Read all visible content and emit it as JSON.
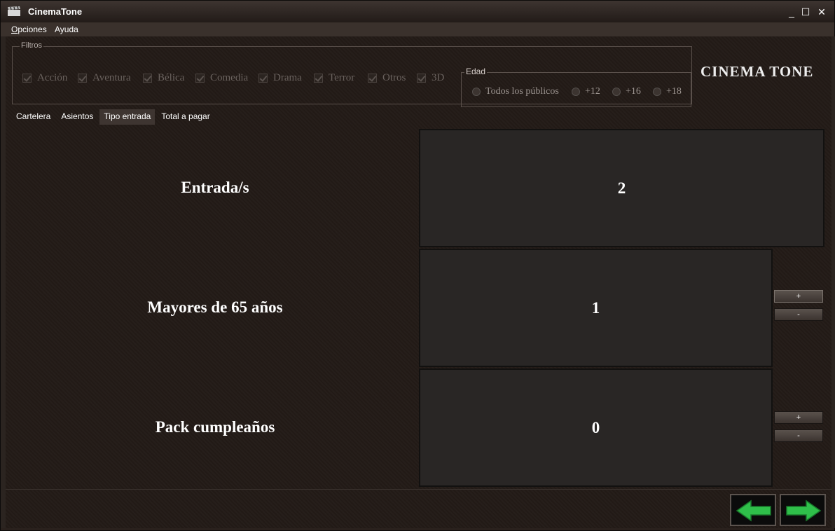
{
  "window": {
    "title": "CinemaTone",
    "minimize": "_",
    "maximize": "☐",
    "close": "✕"
  },
  "menu": {
    "opciones": {
      "accel": "O",
      "rest": "pciones"
    },
    "ayuda": "Ayuda"
  },
  "filtros": {
    "title": "Filtros",
    "genres": [
      "Acción",
      "Aventura",
      "Bélica",
      "Comedia",
      "Drama",
      "Terror",
      "Otros",
      "3D"
    ]
  },
  "edad": {
    "title": "Edad",
    "options": [
      "Todos los públicos",
      "+12",
      "+16",
      "+18"
    ]
  },
  "brand": "CINEMA TONE",
  "tabs": [
    "Cartelera",
    "Asientos",
    "Tipo entrada",
    "Total a pagar"
  ],
  "active_tab": "Tipo entrada",
  "rows": [
    {
      "label": "Entrada/s",
      "value": "2"
    },
    {
      "label": "Mayores de 65 años",
      "value": "1"
    },
    {
      "label": "Pack cumpleaños",
      "value": "0"
    }
  ],
  "stepper": {
    "plus": "+",
    "minus": "-"
  },
  "colors": {
    "accent_arrow": "#2fbf4a",
    "background": "#231b17"
  },
  "icons": {
    "back": "left-arrow-icon",
    "next": "right-arrow-icon"
  }
}
